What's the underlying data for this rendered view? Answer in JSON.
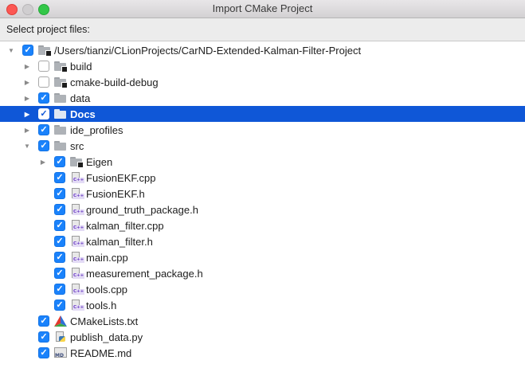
{
  "window": {
    "title": "Import CMake Project"
  },
  "prompt": "Select project files:",
  "tree": [
    {
      "label": "/Users/tianzi/CLionProjects/CarND-Extended-Kalman-Filter-Project",
      "level": 0,
      "arrow": "expanded",
      "checked": true,
      "icon": "folder-linked-icon",
      "selected": false
    },
    {
      "label": "build",
      "level": 1,
      "arrow": "collapsed",
      "checked": false,
      "icon": "folder-linked-icon",
      "selected": false
    },
    {
      "label": "cmake-build-debug",
      "level": 1,
      "arrow": "collapsed",
      "checked": false,
      "icon": "folder-linked-icon",
      "selected": false
    },
    {
      "label": "data",
      "level": 1,
      "arrow": "collapsed",
      "checked": true,
      "icon": "folder-icon",
      "selected": false
    },
    {
      "label": "Docs",
      "level": 1,
      "arrow": "collapsed",
      "checked": true,
      "icon": "folder-icon",
      "selected": true
    },
    {
      "label": "ide_profiles",
      "level": 1,
      "arrow": "collapsed",
      "checked": true,
      "icon": "folder-icon",
      "selected": false
    },
    {
      "label": "src",
      "level": 1,
      "arrow": "expanded",
      "checked": true,
      "icon": "folder-icon",
      "selected": false
    },
    {
      "label": "Eigen",
      "level": 2,
      "arrow": "collapsed",
      "checked": true,
      "icon": "folder-linked-icon",
      "selected": false
    },
    {
      "label": "FusionEKF.cpp",
      "level": 2,
      "arrow": "none",
      "checked": true,
      "icon": "cpp-file-icon",
      "selected": false
    },
    {
      "label": "FusionEKF.h",
      "level": 2,
      "arrow": "none",
      "checked": true,
      "icon": "cpp-file-icon",
      "selected": false
    },
    {
      "label": "ground_truth_package.h",
      "level": 2,
      "arrow": "none",
      "checked": true,
      "icon": "cpp-file-icon",
      "selected": false
    },
    {
      "label": "kalman_filter.cpp",
      "level": 2,
      "arrow": "none",
      "checked": true,
      "icon": "cpp-file-icon",
      "selected": false
    },
    {
      "label": "kalman_filter.h",
      "level": 2,
      "arrow": "none",
      "checked": true,
      "icon": "cpp-file-icon",
      "selected": false
    },
    {
      "label": "main.cpp",
      "level": 2,
      "arrow": "none",
      "checked": true,
      "icon": "cpp-file-icon",
      "selected": false
    },
    {
      "label": "measurement_package.h",
      "level": 2,
      "arrow": "none",
      "checked": true,
      "icon": "cpp-file-icon",
      "selected": false
    },
    {
      "label": "tools.cpp",
      "level": 2,
      "arrow": "none",
      "checked": true,
      "icon": "cpp-file-icon",
      "selected": false
    },
    {
      "label": "tools.h",
      "level": 2,
      "arrow": "none",
      "checked": true,
      "icon": "cpp-file-icon",
      "selected": false
    },
    {
      "label": "CMakeLists.txt",
      "level": 1,
      "arrow": "none",
      "checked": true,
      "icon": "cmake-icon",
      "selected": false
    },
    {
      "label": "publish_data.py",
      "level": 1,
      "arrow": "none",
      "checked": true,
      "icon": "python-file-icon",
      "selected": false
    },
    {
      "label": "README.md",
      "level": 1,
      "arrow": "none",
      "checked": true,
      "icon": "markdown-file-icon",
      "selected": false
    }
  ],
  "colors": {
    "selection": "#0f57d7",
    "checkbox": "#1a82fb",
    "window_bg": "#ececec"
  }
}
